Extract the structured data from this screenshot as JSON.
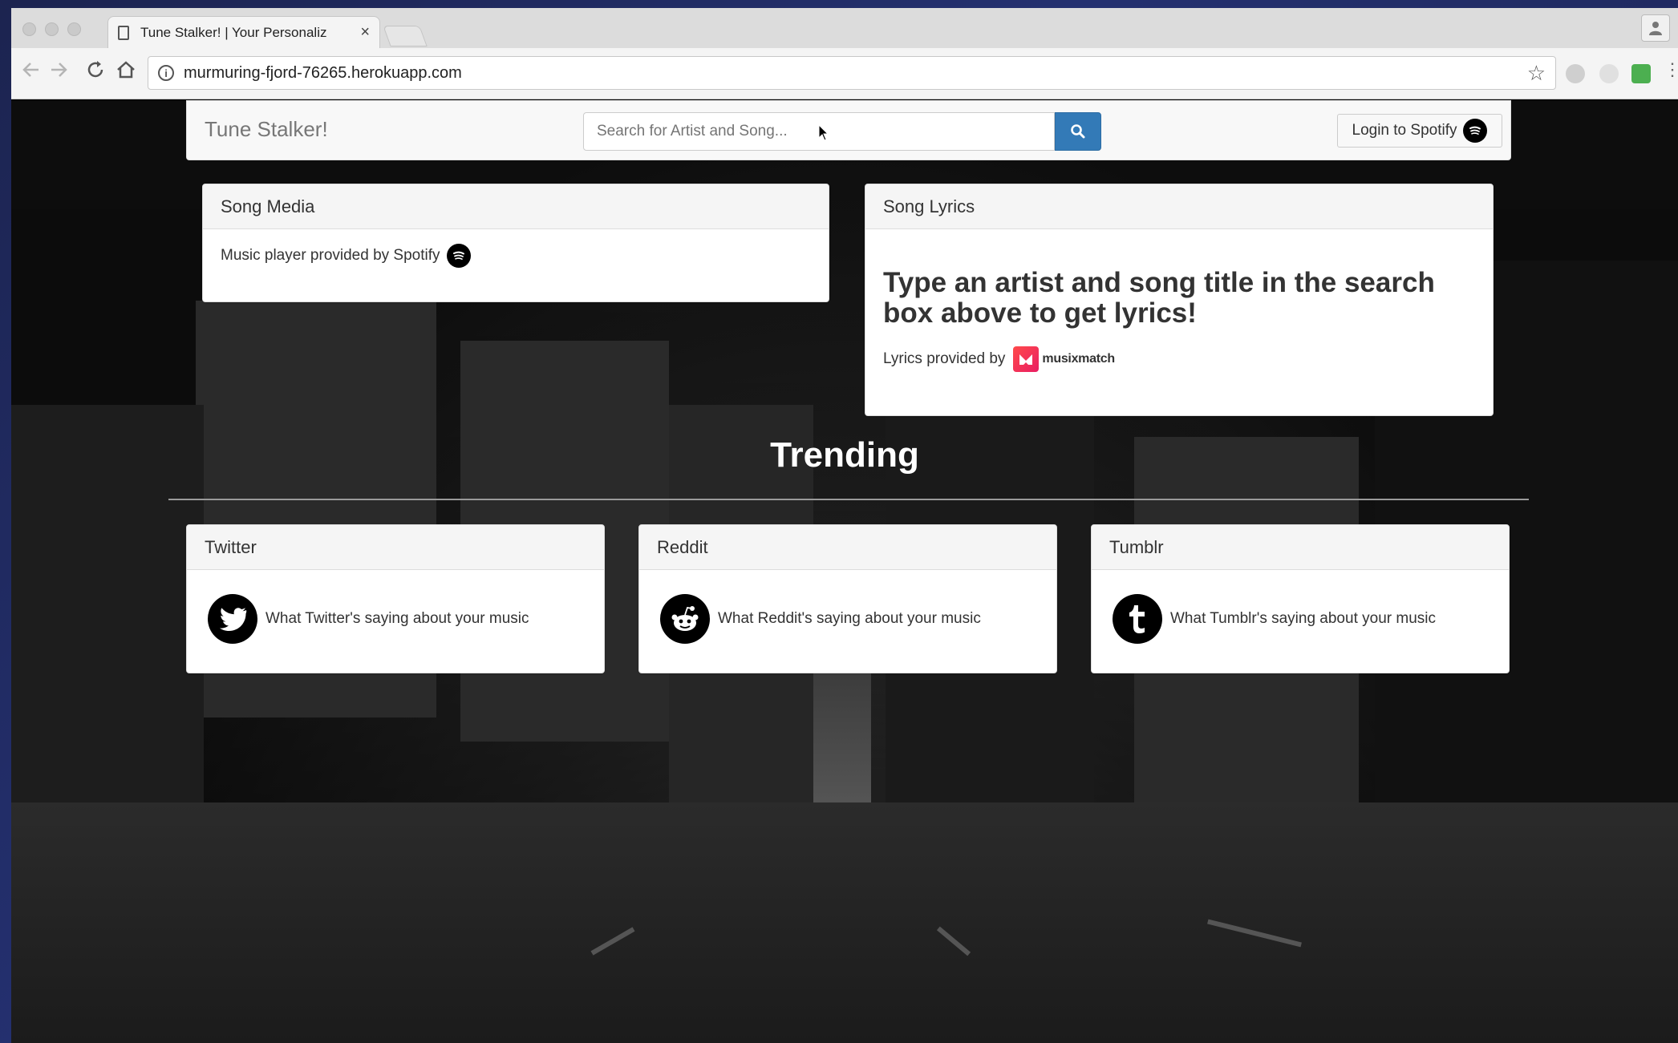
{
  "browser": {
    "tab_title": "Tune Stalker! | Your Personaliz",
    "tab_close": "×",
    "url": "murmuring-fjord-76265.herokuapp.com"
  },
  "navbar": {
    "brand": "Tune Stalker!",
    "search_placeholder": "Search for Artist and Song...",
    "login_label": "Login to Spotify"
  },
  "song_media": {
    "title": "Song Media",
    "body": "Music player provided by Spotify"
  },
  "song_lyrics": {
    "title": "Song Lyrics",
    "headline": "Type an artist and song title in the search box above to get lyrics!",
    "credit": "Lyrics provided by",
    "brand": "musixmatch"
  },
  "trending": {
    "heading": "Trending",
    "cards": [
      {
        "title": "Twitter",
        "text": "What Twitter's saying about your music",
        "icon": "twitter-icon"
      },
      {
        "title": "Reddit",
        "text": "What Reddit's saying about your music",
        "icon": "reddit-icon"
      },
      {
        "title": "Tumblr",
        "text": "What Tumblr's saying about your music",
        "icon": "tumblr-icon"
      }
    ]
  },
  "colors": {
    "primary_button": "#337ab7",
    "panel_heading_bg": "#f5f5f5",
    "musixmatch": "#ff4a4a"
  }
}
